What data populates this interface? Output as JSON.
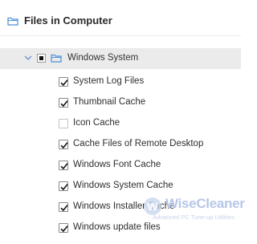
{
  "header": {
    "title": "Files in Computer",
    "icon": "folder-icon"
  },
  "group": {
    "label": "Windows System",
    "expanded": true,
    "state": "partial"
  },
  "items": [
    {
      "label": "System Log Files",
      "checked": true
    },
    {
      "label": "Thumbnail Cache",
      "checked": true
    },
    {
      "label": "Icon Cache",
      "checked": false
    },
    {
      "label": "Cache Files of Remote Desktop",
      "checked": true
    },
    {
      "label": "Windows Font Cache",
      "checked": true
    },
    {
      "label": "Windows System Cache",
      "checked": true
    },
    {
      "label": "Windows Installer Cache",
      "checked": true
    },
    {
      "label": "Windows update files",
      "checked": true
    }
  ],
  "watermark": {
    "brand": "WiseCleaner",
    "tagline": "Advanced PC Tune-up Utilities"
  },
  "colors": {
    "folder": "#4d8fd6",
    "check": "#1a1a1a",
    "group_bg": "#ebebeb",
    "watermark": "#b7c7e8"
  }
}
